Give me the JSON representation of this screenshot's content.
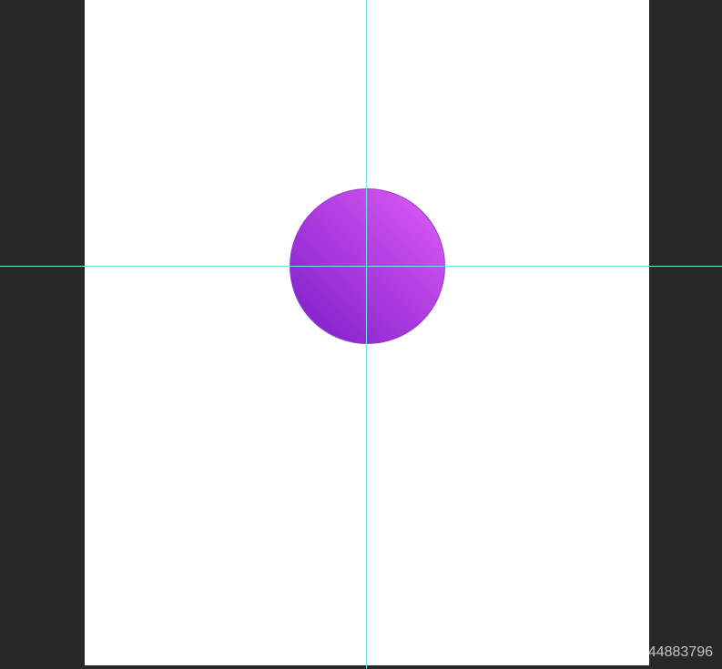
{
  "colors": {
    "workspace_background": "#282828",
    "canvas_background": "#ffffff",
    "guide_line": "#6fe8e2",
    "circle_gradient_start": "#e05cf8",
    "circle_gradient_end": "#7a1cc8",
    "circle_stroke": "#8d3fc8"
  },
  "watermark": {
    "text": "https://blog.csdn.net/qq_44883796"
  }
}
